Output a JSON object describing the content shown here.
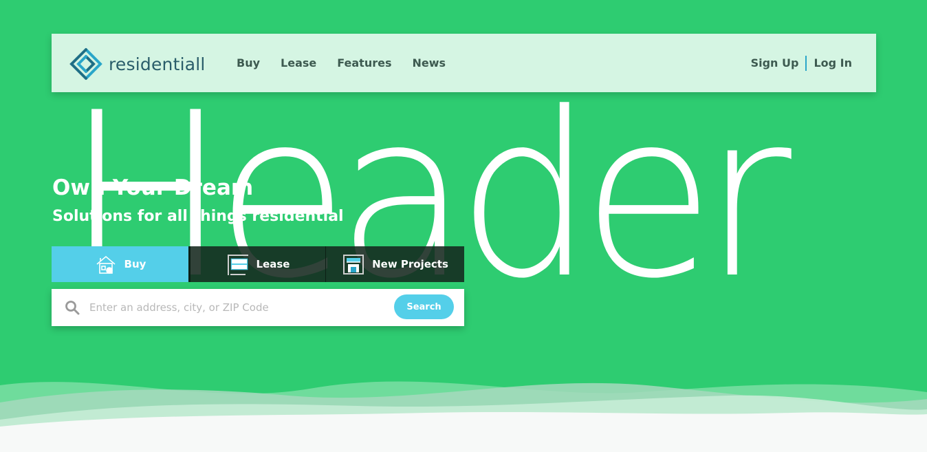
{
  "brand": {
    "name": "residentiall"
  },
  "nav": {
    "links": [
      "Buy",
      "Lease",
      "Features",
      "News"
    ],
    "sign_up": "Sign Up",
    "log_in": "Log In"
  },
  "hero": {
    "watermark": "Header",
    "title": "Own Your Dream",
    "subtitle": "Solutions for all things residential"
  },
  "tabs": [
    {
      "label": "Buy",
      "icon": "house-icon",
      "active": true
    },
    {
      "label": "Lease",
      "icon": "for-rent-sign-icon",
      "active": false
    },
    {
      "label": "New Projects",
      "icon": "building-icon",
      "active": false
    }
  ],
  "search": {
    "placeholder": "Enter an address, city, or ZIP Code",
    "button": "Search",
    "icon": "search-icon"
  },
  "colors": {
    "background": "#2ecc71",
    "navbar": "#d5f5e3",
    "accent": "#54cfe9",
    "dark_tab": "#14281e",
    "text_dark": "#3d5a50"
  }
}
